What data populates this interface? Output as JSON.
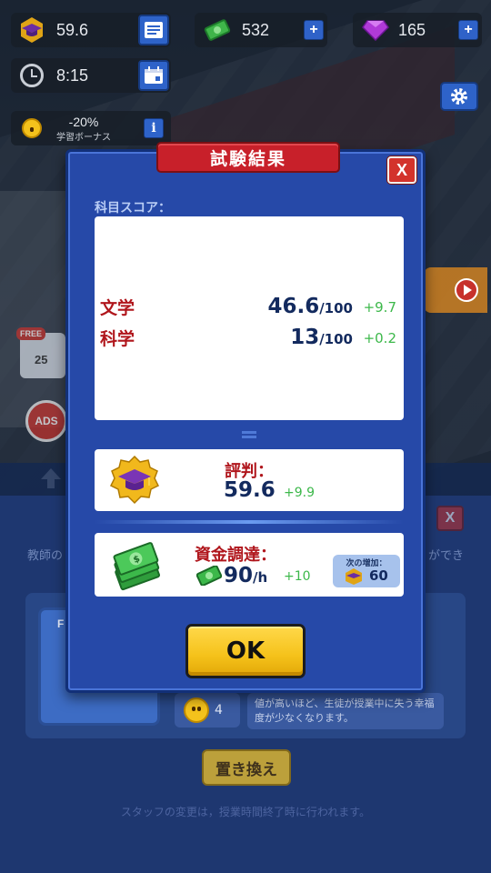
{
  "hud": {
    "reputation": "59.6",
    "cash": "532",
    "gems": "165",
    "time": "8:15",
    "bonus_percent": "-20%",
    "bonus_label": "学習ボーナス",
    "plus_label": "+",
    "info_label": "i"
  },
  "side": {
    "free_label": "FREE",
    "calendar_day": "25",
    "ads_label": "ADS"
  },
  "modal": {
    "title": "試験結果",
    "close_label": "X",
    "subject_scores_label": "科目スコア：",
    "subjects": [
      {
        "name": "文学",
        "score": "46.6",
        "max": "/100",
        "delta": "+9.7"
      },
      {
        "name": "科学",
        "score": "13",
        "max": "/100",
        "delta": "+0.2"
      }
    ],
    "reputation": {
      "label": "評判：",
      "value": "59.6",
      "delta": "+9.9"
    },
    "funding": {
      "label": "資金調達：",
      "value": "90",
      "unit": "/h",
      "delta": "+10",
      "next_label": "次の増加：",
      "next_value": "60"
    },
    "ok_label": "OK"
  },
  "staff_panel": {
    "close_label": "X",
    "desc_left": "教師の",
    "desc_right": "ができ",
    "portrait_tag": "F",
    "happiness_value": "4",
    "note": "値が高いほど、生徒が授業中に失う幸福度が少なくなります。",
    "replace_label": "置き換え",
    "footer": "スタッフの変更は，授業時間終了時に行われます。"
  },
  "colors": {
    "modal_bg": "#2649a8",
    "title_red": "#c8202a",
    "subject_red": "#b0161c",
    "score_navy": "#132a5e",
    "delta_green": "#3cb84a",
    "ok_yellow": "#f5c21a"
  }
}
